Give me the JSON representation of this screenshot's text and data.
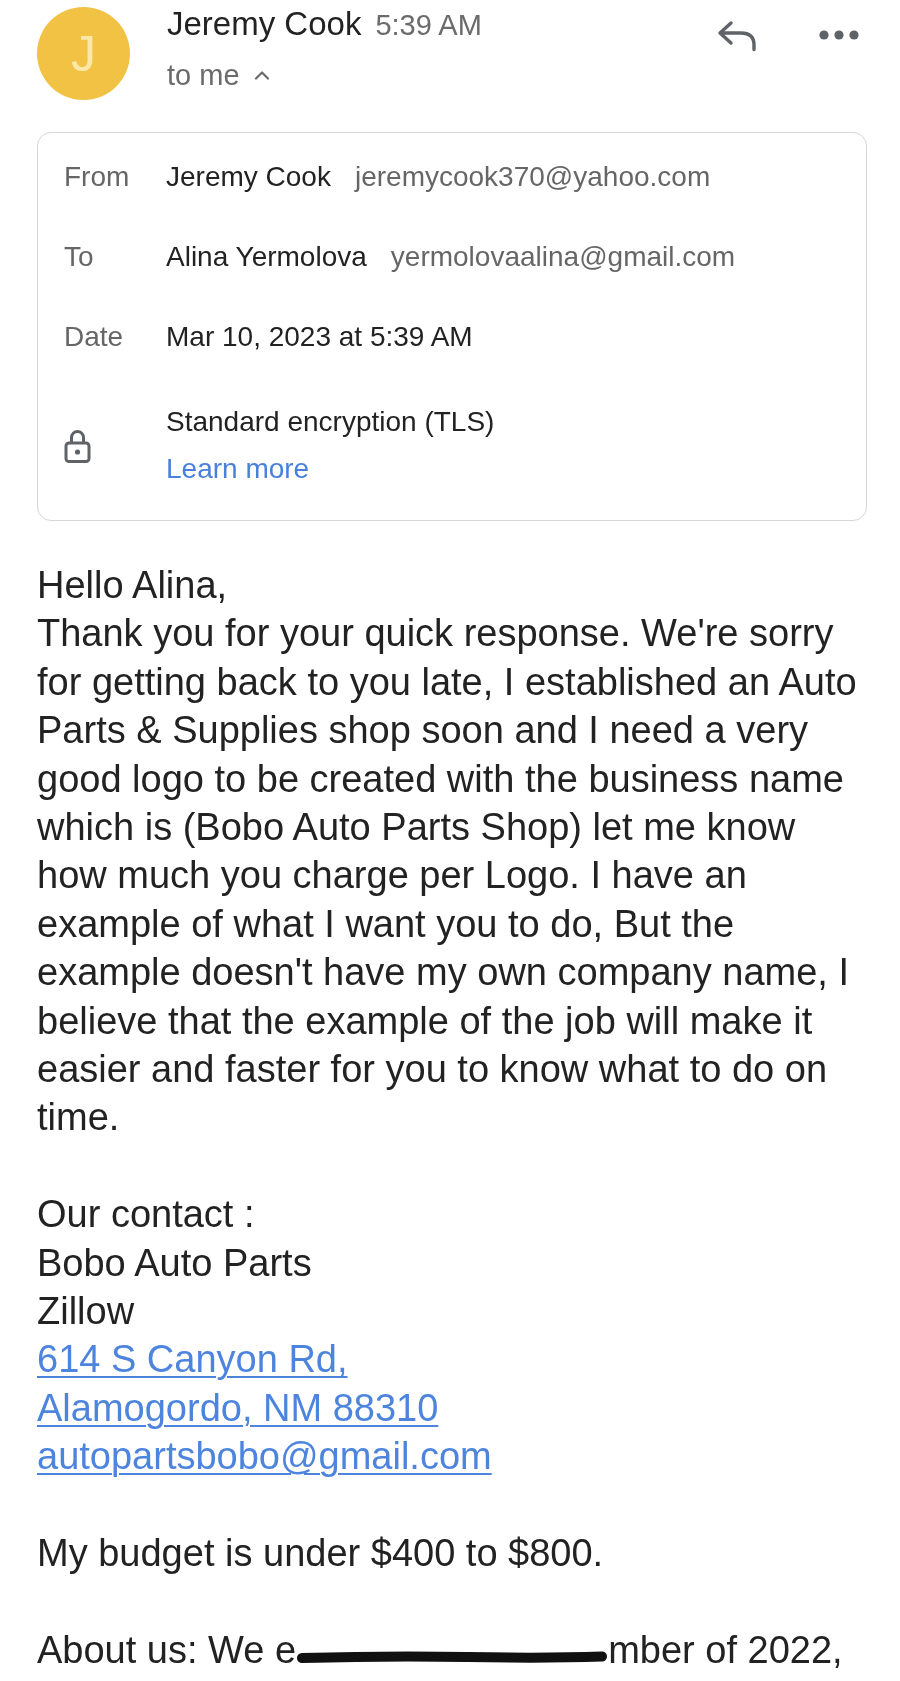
{
  "header": {
    "avatar_letter": "J",
    "sender": "Jeremy Cook",
    "time": "5:39 AM",
    "recipient": "to me",
    "details_expanded": true
  },
  "details": {
    "rows": [
      {
        "label": "From",
        "name": "Jeremy Cook",
        "email": "jeremycook370@yahoo.com"
      },
      {
        "label": "To",
        "name": "Alina Yermolova",
        "email": "yermolovaalina@gmail.com"
      },
      {
        "label": "Date",
        "name": "Mar 10, 2023 at 5:39 AM"
      }
    ],
    "security": {
      "text": "Standard encryption (TLS)",
      "link": "Learn more"
    }
  },
  "body": {
    "paragraphs": [
      {
        "lines": [
          {
            "kind": "text",
            "text": "Hello Alina,"
          },
          {
            "kind": "text",
            "text": "Thank you for your quick response. We're sorry for getting back to you late, I established an Auto Parts & Supplies shop soon and I need a very good logo to be created with the business name which is (Bobo Auto Parts Shop) let me know how much you charge per Logo. I have an example of what I want you to do, But the example doesn't have my own company name, I believe that the example of the job will make it easier and faster for you to know what to do on time."
          }
        ]
      },
      {
        "lines": [
          {
            "kind": "text",
            "text": "Our contact :"
          },
          {
            "kind": "text",
            "text": "Bobo Auto Parts"
          },
          {
            "kind": "text",
            "text": "Zillow"
          },
          {
            "kind": "link",
            "text": "614 S Canyon Rd,"
          },
          {
            "kind": "link",
            "text": "Alamogordo, NM 88310"
          },
          {
            "kind": "link",
            "text": "autopartsbobo@gmail.com"
          }
        ]
      },
      {
        "lines": [
          {
            "kind": "text",
            "text": "My budget is under $400 to $800."
          }
        ]
      },
      {
        "lines": [
          {
            "kind": "scribbled",
            "before": "About us: We e",
            "after": "mber of 2022,"
          }
        ]
      }
    ]
  }
}
